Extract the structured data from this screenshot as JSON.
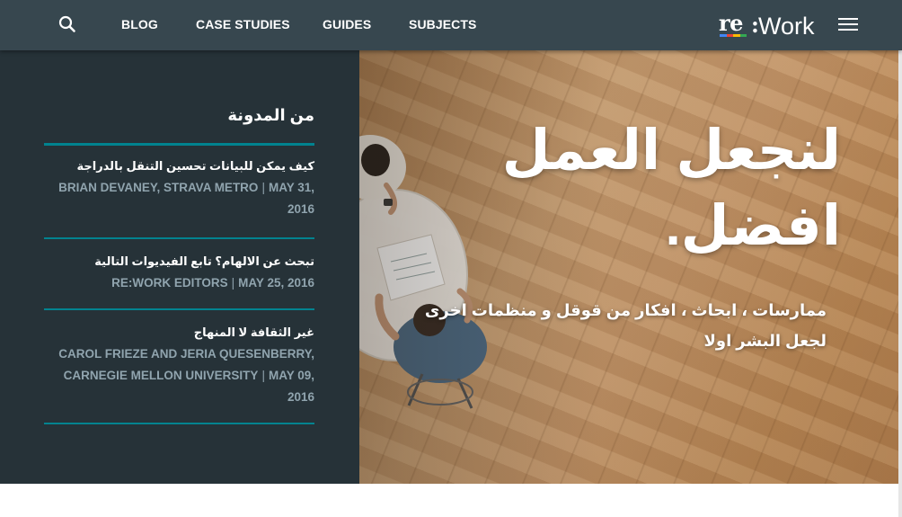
{
  "nav": {
    "search_icon": "search-icon",
    "links": [
      "BLOG",
      "CASE STUDIES",
      "GUIDES",
      "SUBJECTS"
    ],
    "logo_re": "re",
    "logo_work": "Work",
    "logo_colon": ":",
    "logo_stripe_colors": [
      "#4285f4",
      "#ea4335",
      "#fbbc05",
      "#34a853"
    ],
    "menu_icon": "hamburger-menu-icon"
  },
  "blog": {
    "heading": "من المدونة",
    "posts": [
      {
        "title": "كيف يمكن للبيانات تحسين التنقل بالدراجة",
        "author": "BRIAN DEVANEY, STRAVA METRO",
        "date": "MAY 31, 2016"
      },
      {
        "title": "تبحث عن الالهام؟ تابع الفيديوات التالية",
        "author": "RE:WORK EDITORS",
        "date": "MAY 25, 2016"
      },
      {
        "title": "غير الثقافة لا المنهاج",
        "author": "CAROL FRIEZE AND JERIA QUESENBERRY, CARNEGIE MELLON UNIVERSITY",
        "date": "MAY 09, 2016"
      }
    ]
  },
  "hero": {
    "headline": "لنجعل العمل افضل.",
    "subtitle": "ممارسات ، ابحاث ، افكار من قوقل و منظمات اخرى لجعل البشر اولا"
  },
  "colors": {
    "nav_bg": "#37474f",
    "panel_bg": "#263238",
    "accent": "#00838f",
    "meta_text": "#90a4ae"
  }
}
